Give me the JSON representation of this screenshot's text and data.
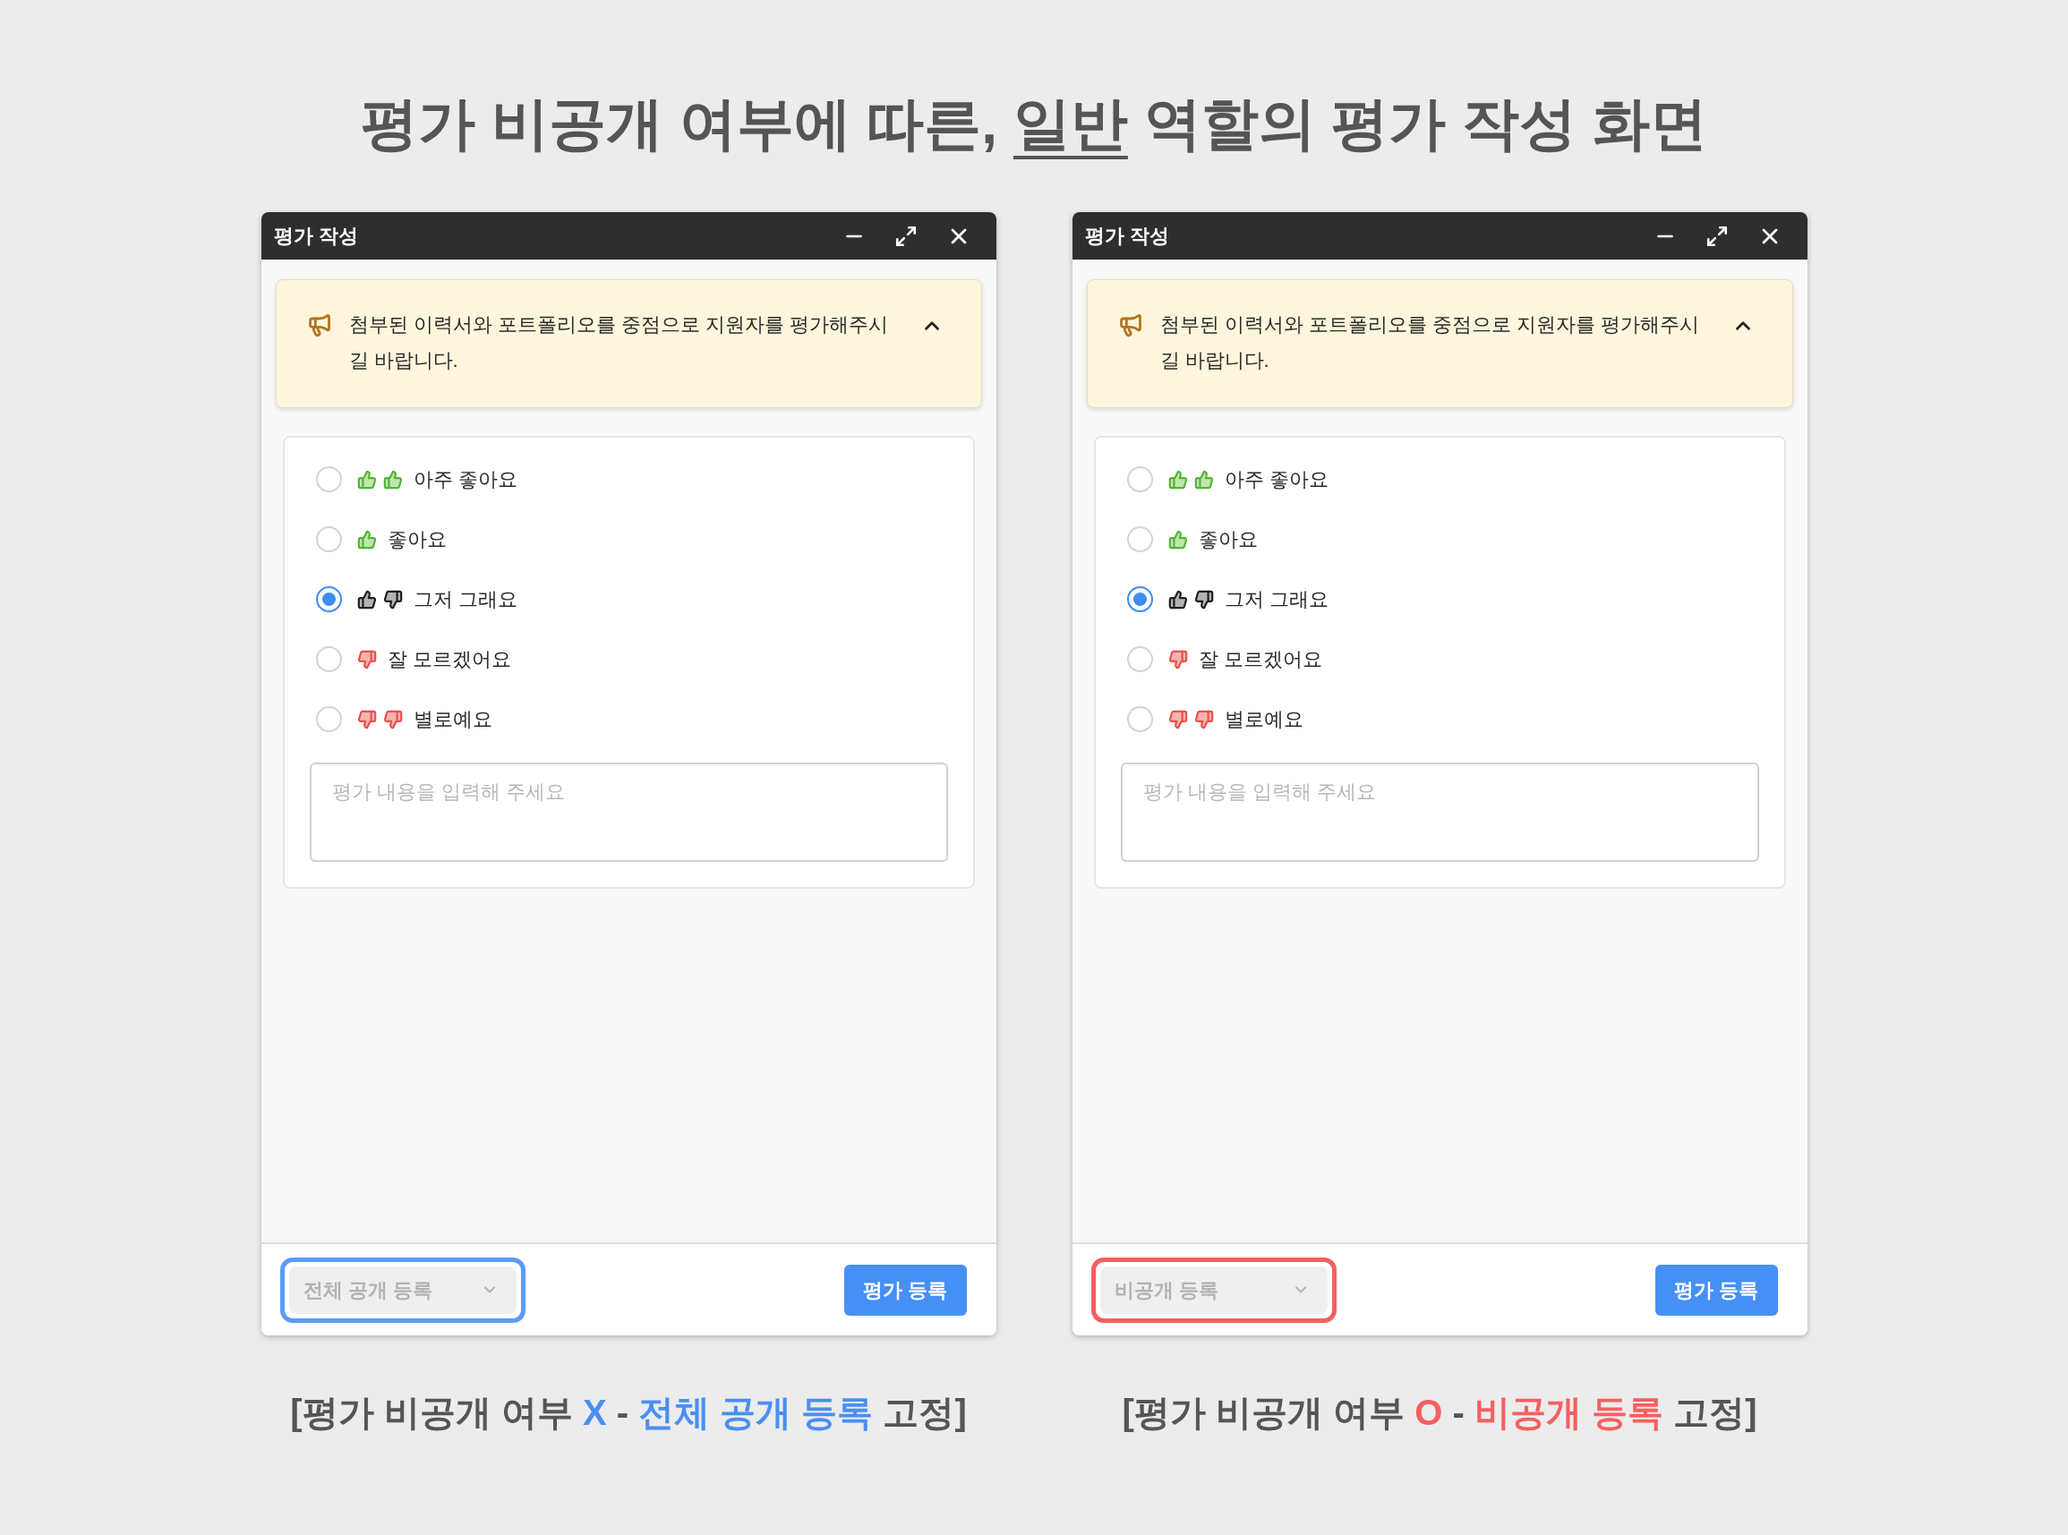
{
  "heading": {
    "segments": [
      {
        "text": "평가 비공개 여부에 따른, ",
        "underline": false
      },
      {
        "text": "일반",
        "underline": true
      },
      {
        "text": " 역할의 평가 작성 화면",
        "underline": false
      }
    ]
  },
  "panels": [
    {
      "window": {
        "title": "평가 작성"
      },
      "notice": {
        "text": "첨부된 이력서와 포트폴리오를 중점으로 지원자를 평가해주시길 바랍니다.",
        "expanded": true
      },
      "options": [
        {
          "kind": "very_good",
          "label": "아주 좋아요",
          "selected": false
        },
        {
          "kind": "good",
          "label": "좋아요",
          "selected": false
        },
        {
          "kind": "neutral",
          "label": "그저 그래요",
          "selected": true
        },
        {
          "kind": "unsure",
          "label": "잘 모르겠어요",
          "selected": false
        },
        {
          "kind": "bad",
          "label": "별로예요",
          "selected": false
        }
      ],
      "comment": {
        "placeholder": "평가 내용을 입력해 주세요"
      },
      "visibility_select": {
        "value": "전체 공개 등록",
        "disabled": true
      },
      "highlight": {
        "color": "#5b9cf6"
      },
      "submit_button": "평가 등록",
      "caption": [
        {
          "text": "[평가 비공개 여부 ",
          "color": "#555555"
        },
        {
          "text": "X",
          "color": "#4a8ff2"
        },
        {
          "text": " - ",
          "color": "#555555"
        },
        {
          "text": "전체 공개 등록",
          "color": "#4a8ff2"
        },
        {
          "text": " 고정]",
          "color": "#555555"
        }
      ]
    },
    {
      "window": {
        "title": "평가 작성"
      },
      "notice": {
        "text": "첨부된 이력서와 포트폴리오를 중점으로 지원자를 평가해주시길 바랍니다.",
        "expanded": true
      },
      "options": [
        {
          "kind": "very_good",
          "label": "아주 좋아요",
          "selected": false
        },
        {
          "kind": "good",
          "label": "좋아요",
          "selected": false
        },
        {
          "kind": "neutral",
          "label": "그저 그래요",
          "selected": true
        },
        {
          "kind": "unsure",
          "label": "잘 모르겠어요",
          "selected": false
        },
        {
          "kind": "bad",
          "label": "별로예요",
          "selected": false
        }
      ],
      "comment": {
        "placeholder": "평가 내용을 입력해 주세요"
      },
      "visibility_select": {
        "value": "비공개 등록",
        "disabled": true
      },
      "highlight": {
        "color": "#f65f5f"
      },
      "submit_button": "평가 등록",
      "caption": [
        {
          "text": "[평가 비공개 여부 ",
          "color": "#555555"
        },
        {
          "text": "O",
          "color": "#f65f5f"
        },
        {
          "text": " - ",
          "color": "#555555"
        },
        {
          "text": "비공개 등록",
          "color": "#f65f5f"
        },
        {
          "text": " 고정]",
          "color": "#555555"
        }
      ]
    }
  ]
}
